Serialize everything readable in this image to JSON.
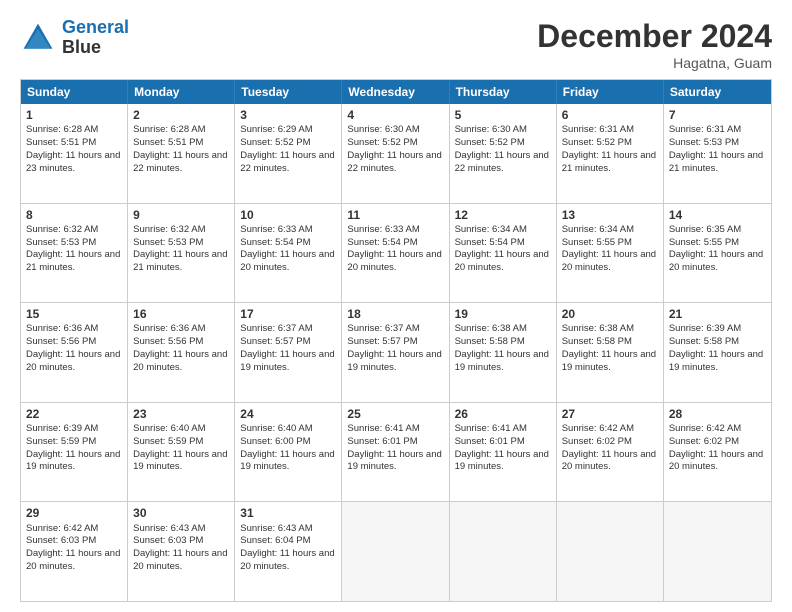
{
  "logo": {
    "line1": "General",
    "line2": "Blue"
  },
  "title": "December 2024",
  "subtitle": "Hagatna, Guam",
  "days": [
    "Sunday",
    "Monday",
    "Tuesday",
    "Wednesday",
    "Thursday",
    "Friday",
    "Saturday"
  ],
  "weeks": [
    [
      {
        "day": "1",
        "sunrise": "6:28 AM",
        "sunset": "5:51 PM",
        "daylight": "11 hours and 23 minutes."
      },
      {
        "day": "2",
        "sunrise": "6:28 AM",
        "sunset": "5:51 PM",
        "daylight": "11 hours and 22 minutes."
      },
      {
        "day": "3",
        "sunrise": "6:29 AM",
        "sunset": "5:52 PM",
        "daylight": "11 hours and 22 minutes."
      },
      {
        "day": "4",
        "sunrise": "6:30 AM",
        "sunset": "5:52 PM",
        "daylight": "11 hours and 22 minutes."
      },
      {
        "day": "5",
        "sunrise": "6:30 AM",
        "sunset": "5:52 PM",
        "daylight": "11 hours and 22 minutes."
      },
      {
        "day": "6",
        "sunrise": "6:31 AM",
        "sunset": "5:52 PM",
        "daylight": "11 hours and 21 minutes."
      },
      {
        "day": "7",
        "sunrise": "6:31 AM",
        "sunset": "5:53 PM",
        "daylight": "11 hours and 21 minutes."
      }
    ],
    [
      {
        "day": "8",
        "sunrise": "6:32 AM",
        "sunset": "5:53 PM",
        "daylight": "11 hours and 21 minutes."
      },
      {
        "day": "9",
        "sunrise": "6:32 AM",
        "sunset": "5:53 PM",
        "daylight": "11 hours and 21 minutes."
      },
      {
        "day": "10",
        "sunrise": "6:33 AM",
        "sunset": "5:54 PM",
        "daylight": "11 hours and 20 minutes."
      },
      {
        "day": "11",
        "sunrise": "6:33 AM",
        "sunset": "5:54 PM",
        "daylight": "11 hours and 20 minutes."
      },
      {
        "day": "12",
        "sunrise": "6:34 AM",
        "sunset": "5:54 PM",
        "daylight": "11 hours and 20 minutes."
      },
      {
        "day": "13",
        "sunrise": "6:34 AM",
        "sunset": "5:55 PM",
        "daylight": "11 hours and 20 minutes."
      },
      {
        "day": "14",
        "sunrise": "6:35 AM",
        "sunset": "5:55 PM",
        "daylight": "11 hours and 20 minutes."
      }
    ],
    [
      {
        "day": "15",
        "sunrise": "6:36 AM",
        "sunset": "5:56 PM",
        "daylight": "11 hours and 20 minutes."
      },
      {
        "day": "16",
        "sunrise": "6:36 AM",
        "sunset": "5:56 PM",
        "daylight": "11 hours and 20 minutes."
      },
      {
        "day": "17",
        "sunrise": "6:37 AM",
        "sunset": "5:57 PM",
        "daylight": "11 hours and 19 minutes."
      },
      {
        "day": "18",
        "sunrise": "6:37 AM",
        "sunset": "5:57 PM",
        "daylight": "11 hours and 19 minutes."
      },
      {
        "day": "19",
        "sunrise": "6:38 AM",
        "sunset": "5:58 PM",
        "daylight": "11 hours and 19 minutes."
      },
      {
        "day": "20",
        "sunrise": "6:38 AM",
        "sunset": "5:58 PM",
        "daylight": "11 hours and 19 minutes."
      },
      {
        "day": "21",
        "sunrise": "6:39 AM",
        "sunset": "5:58 PM",
        "daylight": "11 hours and 19 minutes."
      }
    ],
    [
      {
        "day": "22",
        "sunrise": "6:39 AM",
        "sunset": "5:59 PM",
        "daylight": "11 hours and 19 minutes."
      },
      {
        "day": "23",
        "sunrise": "6:40 AM",
        "sunset": "5:59 PM",
        "daylight": "11 hours and 19 minutes."
      },
      {
        "day": "24",
        "sunrise": "6:40 AM",
        "sunset": "6:00 PM",
        "daylight": "11 hours and 19 minutes."
      },
      {
        "day": "25",
        "sunrise": "6:41 AM",
        "sunset": "6:01 PM",
        "daylight": "11 hours and 19 minutes."
      },
      {
        "day": "26",
        "sunrise": "6:41 AM",
        "sunset": "6:01 PM",
        "daylight": "11 hours and 19 minutes."
      },
      {
        "day": "27",
        "sunrise": "6:42 AM",
        "sunset": "6:02 PM",
        "daylight": "11 hours and 20 minutes."
      },
      {
        "day": "28",
        "sunrise": "6:42 AM",
        "sunset": "6:02 PM",
        "daylight": "11 hours and 20 minutes."
      }
    ],
    [
      {
        "day": "29",
        "sunrise": "6:42 AM",
        "sunset": "6:03 PM",
        "daylight": "11 hours and 20 minutes."
      },
      {
        "day": "30",
        "sunrise": "6:43 AM",
        "sunset": "6:03 PM",
        "daylight": "11 hours and 20 minutes."
      },
      {
        "day": "31",
        "sunrise": "6:43 AM",
        "sunset": "6:04 PM",
        "daylight": "11 hours and 20 minutes."
      },
      null,
      null,
      null,
      null
    ]
  ]
}
